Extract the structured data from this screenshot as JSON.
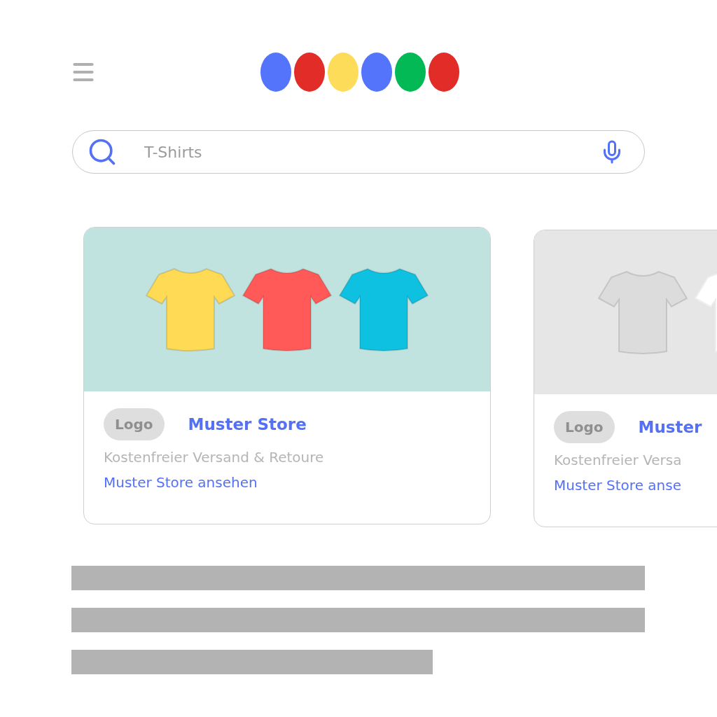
{
  "logo": {
    "dots": [
      {
        "color": "#5474fb"
      },
      {
        "color": "#e22c28"
      },
      {
        "color": "#fddc59"
      },
      {
        "color": "#5474fb"
      },
      {
        "color": "#03b955"
      },
      {
        "color": "#e22c28"
      }
    ]
  },
  "search": {
    "value": "T-Shirts"
  },
  "cards": [
    {
      "color": "#c1e3df",
      "shirts": [
        {
          "color": "#ffda55"
        },
        {
          "color": "#ff5a57"
        },
        {
          "color": "#0ec1e0"
        }
      ],
      "logo": "Logo",
      "store": "Muster Store",
      "shipping": "Kostenfreier Versand & Retoure",
      "link": "Muster Store ansehen"
    },
    {
      "color": "#e6e6e6",
      "shirts": [
        {
          "color": "#dcdcdc"
        },
        {
          "color": "#ffffff"
        }
      ],
      "logo": "Logo",
      "store": "Muster",
      "shipping": "Kostenfreier Versa",
      "link": "Muster Store anse"
    }
  ],
  "text_lines": [
    {
      "kind": "full"
    },
    {
      "kind": "full"
    },
    {
      "kind": "short"
    }
  ]
}
